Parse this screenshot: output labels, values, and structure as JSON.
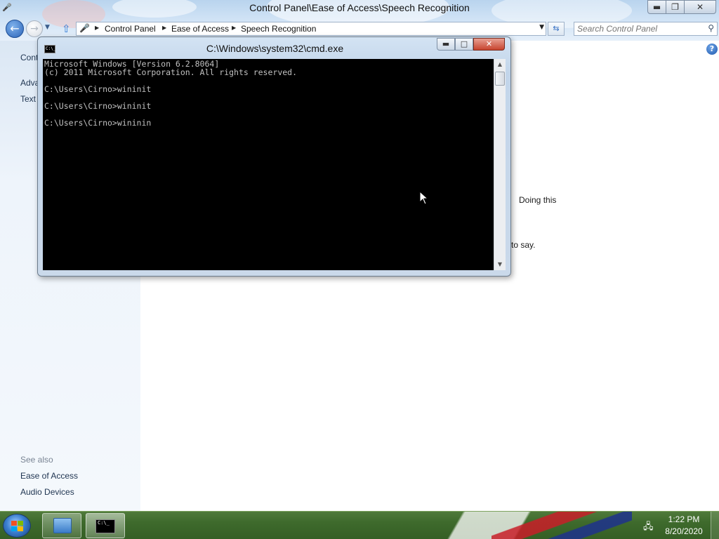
{
  "control_panel": {
    "title": "Control Panel\\Ease of Access\\Speech Recognition",
    "breadcrumbs": [
      "Control Panel",
      "Ease of Access",
      "Speech Recognition"
    ],
    "search_placeholder": "Search Control Panel",
    "left_links_truncated": [
      "Cont",
      "Adva",
      "Text"
    ],
    "see_also": {
      "heading": "See also",
      "links": [
        "Ease of Access",
        "Audio Devices"
      ]
    },
    "content_fragments": [
      "Doing this",
      "to say."
    ],
    "help_label": "?"
  },
  "cmd": {
    "title": "C:\\Windows\\system32\\cmd.exe",
    "lines": [
      "Microsoft Windows [Version 6.2.8064]",
      "(c) 2011 Microsoft Corporation. All rights reserved.",
      "",
      "C:\\Users\\Cirno>wininit",
      "",
      "C:\\Users\\Cirno>wininit",
      "",
      "C:\\Users\\Cirno>wininin"
    ]
  },
  "taskbar": {
    "clock_time": "1:22 PM",
    "clock_date": "8/20/2020"
  },
  "icons": {
    "back": "back-arrow-icon",
    "forward": "forward-arrow-icon",
    "up": "up-arrow-icon",
    "refresh": "refresh-icon",
    "search": "search-icon",
    "help": "help-icon",
    "network": "network-icon",
    "cursor": "mouse-cursor-icon"
  }
}
